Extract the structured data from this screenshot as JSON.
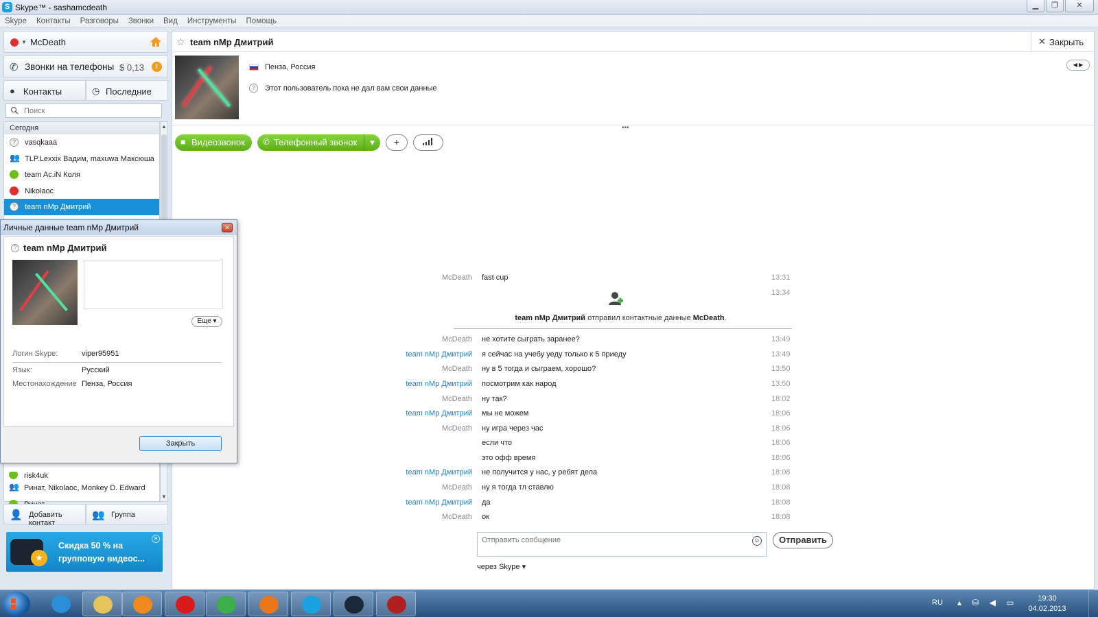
{
  "window": {
    "title": "Skype™ - sashamcdeath",
    "logo": "S"
  },
  "menu": [
    "Skype",
    "Контакты",
    "Разговоры",
    "Звонки",
    "Вид",
    "Инструменты",
    "Помощь"
  ],
  "sidebar": {
    "me": {
      "name": "McDeath",
      "status_color": "#e03030"
    },
    "calls": {
      "label": "Звонки на телефоны",
      "credit": "$ 0,13"
    },
    "tabs": [
      {
        "label": "Контакты"
      },
      {
        "label": "Последние"
      }
    ],
    "search": {
      "placeholder": "Поиск"
    },
    "group_today": "Сегодня",
    "contacts": [
      {
        "name": "vasqkaaa",
        "status": "unknown"
      },
      {
        "name": "TLP.Lexxix Вадим, maxuwa Максюша",
        "status": "group"
      },
      {
        "name": "team Ac.iN Коля",
        "status": "online"
      },
      {
        "name": "Nikolaoc",
        "status": "offline"
      },
      {
        "name": "team nMp Дмитрий",
        "status": "unknown",
        "selected": true
      }
    ],
    "bottom_contacts": [
      {
        "name": "risk4uk",
        "status": "online"
      },
      {
        "name": "Ринат, Nikolaoc, Monkey D. Edward",
        "status": "group"
      },
      {
        "name": "Ринат",
        "status": "online"
      }
    ],
    "actions": {
      "add_contact": "Добавить контакт",
      "group": "Группа"
    },
    "promo": {
      "text": "Скидка 50 % на групповую видеос..."
    }
  },
  "conversation": {
    "title": "team nMp Дмитрий",
    "close_label": "Закрыть",
    "location": "Пенза, Россия",
    "no_data": "Этот пользователь пока не дал вам свои данные",
    "buttons": {
      "video": "Видеозвонок",
      "phone": "Телефонный звонок",
      "add": "+"
    },
    "messages": [
      {
        "who": "McDeath",
        "them": false,
        "text": "fast cup",
        "time": "13:31"
      },
      {
        "who": "",
        "them": false,
        "text": "",
        "time": "13:34"
      },
      {
        "who": "McDeath",
        "them": false,
        "text": "не хотите сыграть заранее?",
        "time": "13:49"
      },
      {
        "who": "team nMp Дмитрий",
        "them": true,
        "text": "я сейчас на учебу уеду только к 5 приеду",
        "time": "13:49"
      },
      {
        "who": "McDeath",
        "them": false,
        "text": "ну в 5 тогда и сыграем, хорошо?",
        "time": "13:50"
      },
      {
        "who": "team nMp Дмитрий",
        "them": true,
        "text": "посмотрим как народ",
        "time": "13:50"
      },
      {
        "who": "McDeath",
        "them": false,
        "text": "ну так?",
        "time": "18:02"
      },
      {
        "who": "team nMp Дмитрий",
        "them": true,
        "text": "мы не можем",
        "time": "18:06"
      },
      {
        "who": "McDeath",
        "them": false,
        "text": "ну игра через час",
        "time": "18:06"
      },
      {
        "who": "",
        "them": false,
        "text": "если что",
        "time": "18:06"
      },
      {
        "who": "",
        "them": false,
        "text": "это офф время",
        "time": "18:06"
      },
      {
        "who": "team nMp Дмитрий",
        "them": true,
        "text": "не получится у нас, у ребят дела",
        "time": "18:08"
      },
      {
        "who": "McDeath",
        "them": false,
        "text": "ну я тогда тл ставлю",
        "time": "18:08"
      },
      {
        "who": "team nMp Дмитрий",
        "them": true,
        "text": "да",
        "time": "18:08"
      },
      {
        "who": "McDeath",
        "them": false,
        "text": "ок",
        "time": "18:08"
      }
    ],
    "event": {
      "sender": "team nMp Дмитрий",
      "action": " отправил контактные данные ",
      "target": "McDeath",
      "end": "."
    },
    "compose": {
      "placeholder": "Отправить сообщение",
      "send_label": "Отправить",
      "via": "через Skype"
    }
  },
  "dialog": {
    "title": "Личные данные team nMp Дмитрий",
    "name": "team nMp Дмитрий",
    "more_label": "Еще",
    "fields": [
      {
        "key": "Логин Skype:",
        "value": "viper95951"
      },
      {
        "key": "Язык:",
        "value": "Русский"
      },
      {
        "key": "Местонахождение",
        "value": "Пенза, Россия"
      }
    ],
    "ok_label": "Закрыть"
  },
  "taskbar": {
    "apps": [
      {
        "icon": "ie-icon",
        "color": "#2a8ed8"
      },
      {
        "icon": "explorer-icon",
        "color": "#e6c45c"
      },
      {
        "icon": "media-player-icon",
        "color": "#f08a1c"
      },
      {
        "icon": "opera-icon",
        "color": "#d81a1a"
      },
      {
        "icon": "chrome-icon",
        "color": "#3cae4a"
      },
      {
        "icon": "firefox-icon",
        "color": "#e8771e"
      },
      {
        "icon": "skype-icon",
        "color": "#1aa1e1"
      },
      {
        "icon": "steam-icon",
        "color": "#1b2838"
      },
      {
        "icon": "dota-icon",
        "color": "#b02020"
      }
    ],
    "lang": "RU",
    "time": "19:30",
    "date": "04.02.2013"
  }
}
